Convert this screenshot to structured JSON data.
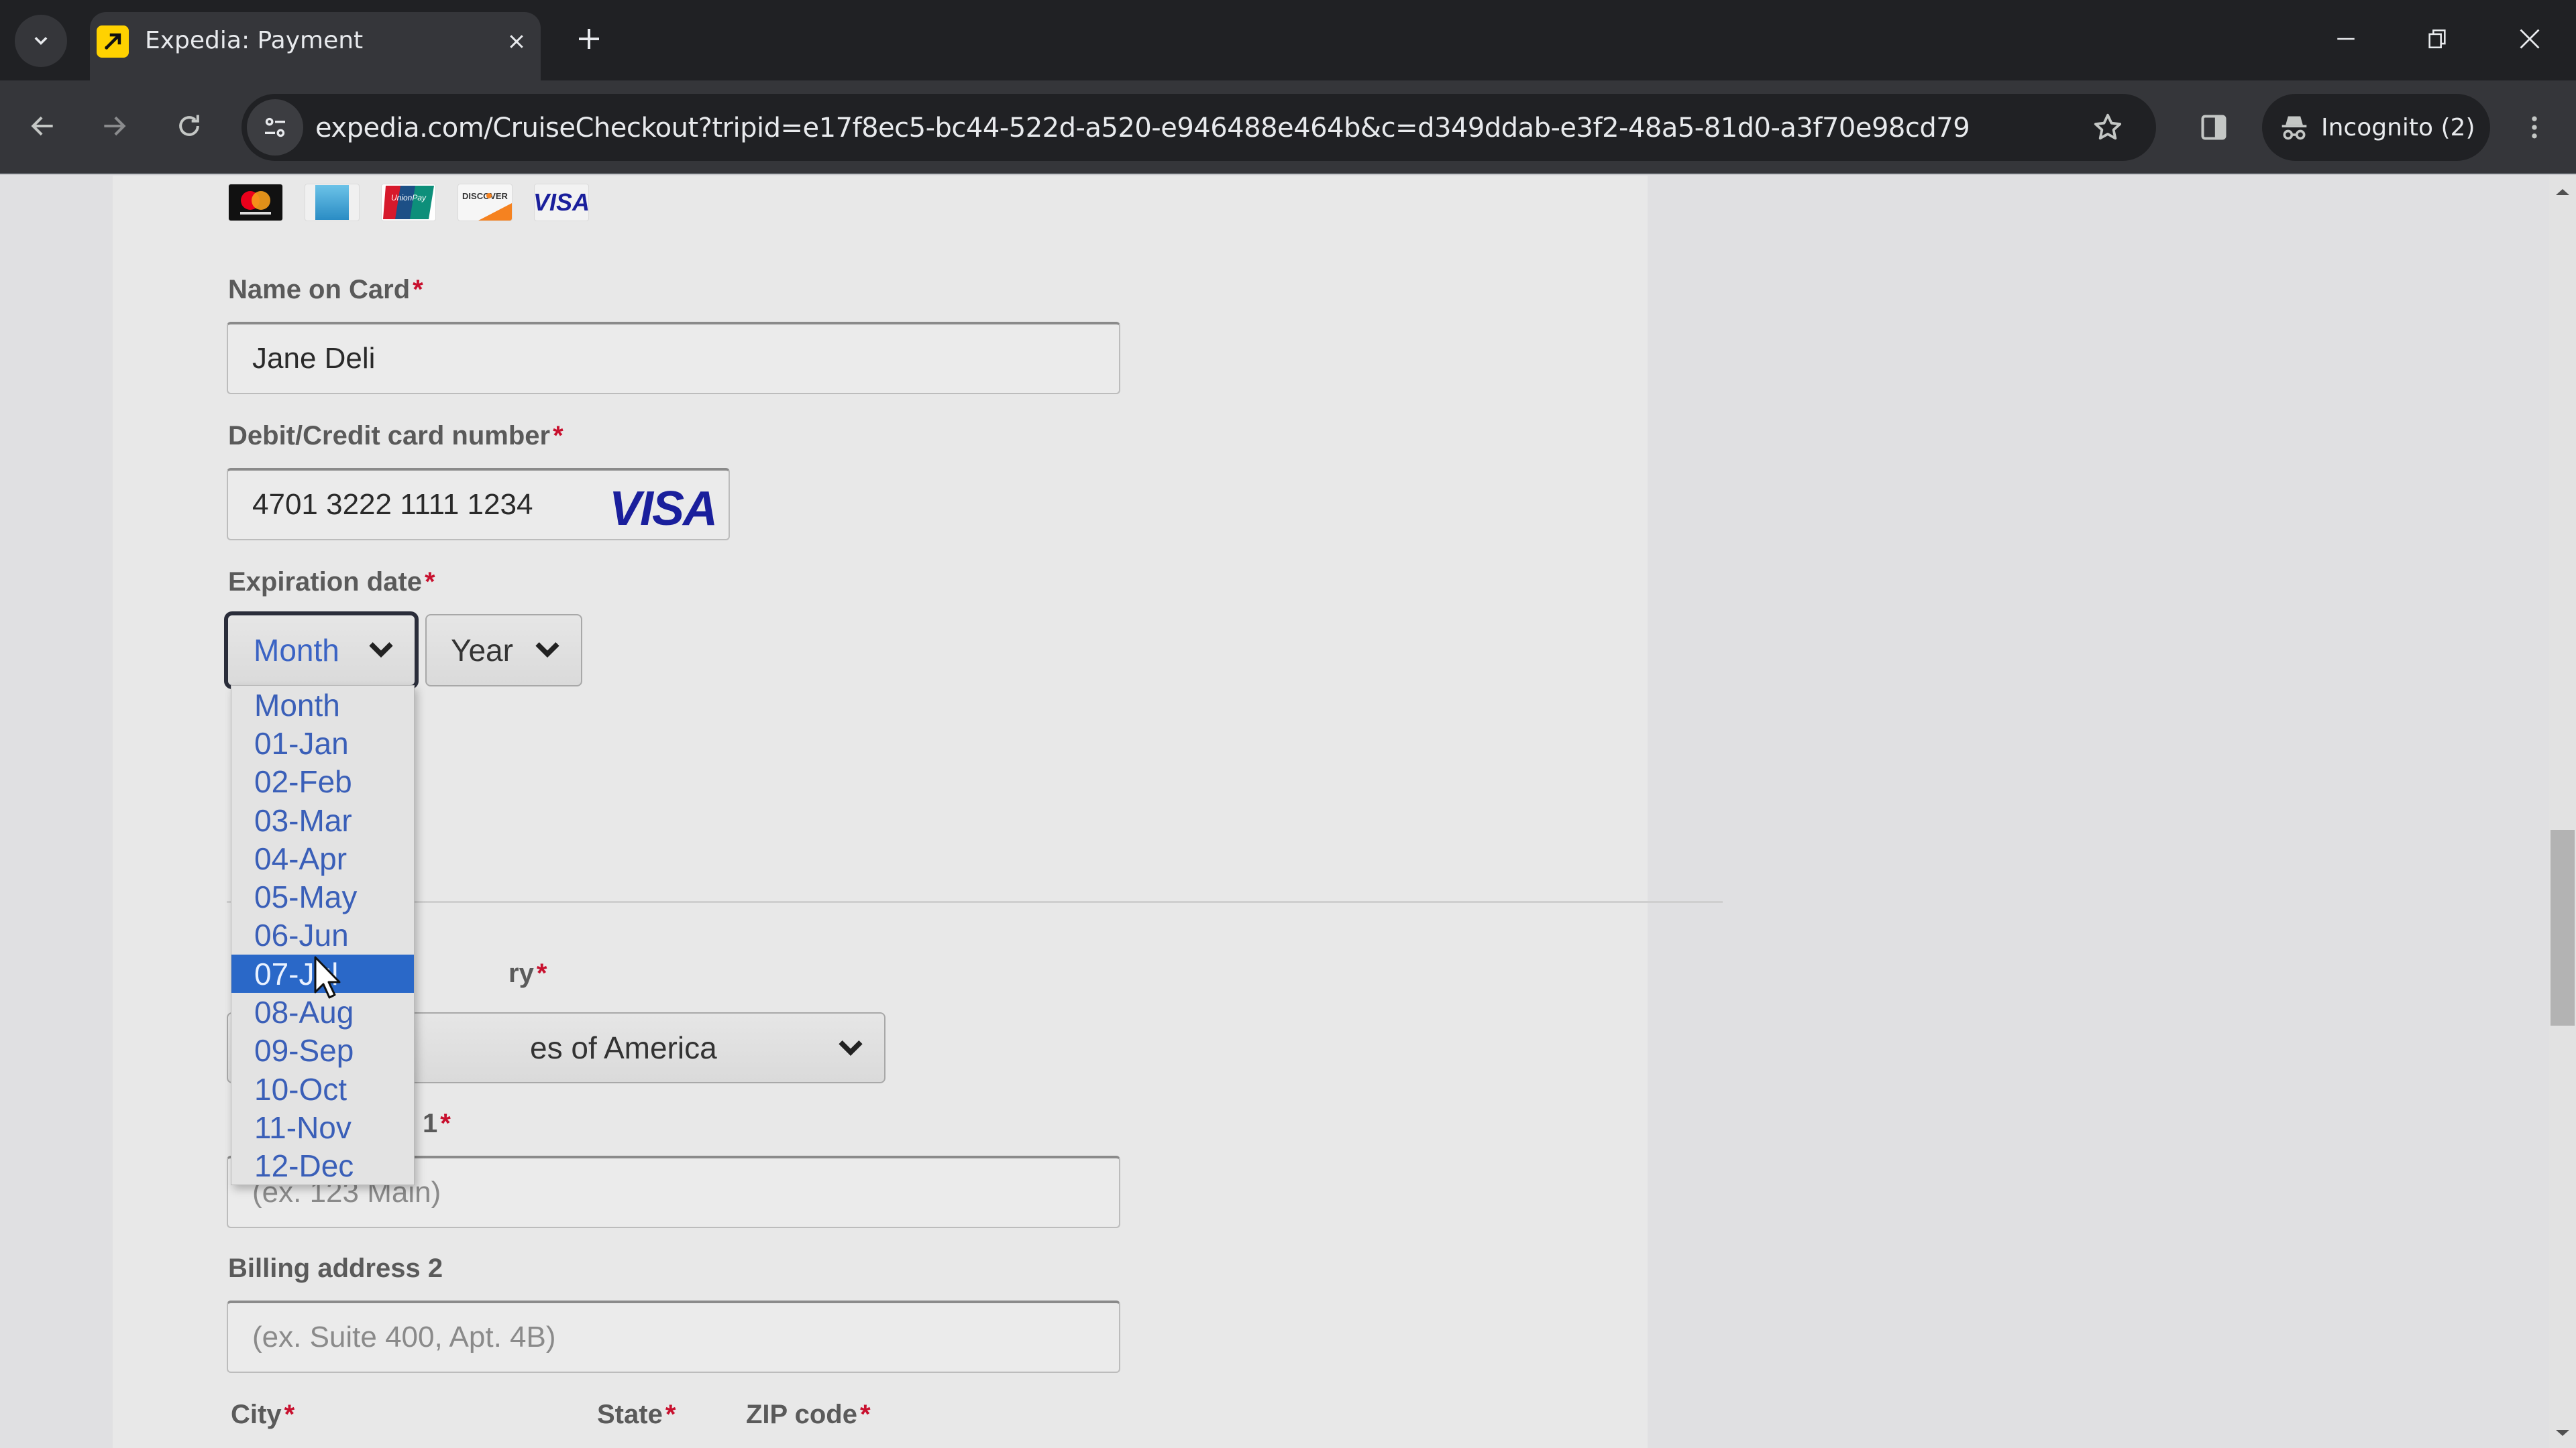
{
  "browser": {
    "tab_title": "Expedia: Payment",
    "url": "expedia.com/CruiseCheckout?tripid=e17f8ec5-bc44-522d-a520-e946488e464b&c=d349ddab-e3f2-48a5-81d0-a3f70e98cd79",
    "incognito_label": "Incognito (2)",
    "icons": {
      "tab_list": "chevron-down-icon",
      "favicon": "expedia-logo-icon",
      "tab_close": "close-icon",
      "new_tab": "plus-icon",
      "minimize": "minimize-icon",
      "restore": "restore-icon",
      "close_window": "close-icon",
      "back": "arrow-left-icon",
      "forward": "arrow-right-icon",
      "reload": "reload-icon",
      "site_info": "tune-icon",
      "bookmark": "star-icon",
      "side_panel": "side-panel-icon",
      "incognito": "incognito-icon",
      "menu": "more-vertical-icon"
    },
    "colors": {
      "favicon_bg": "#ffd200",
      "tabstrip": "#202124",
      "toolbar": "#35363a"
    }
  },
  "payment_form": {
    "accepted_cards": [
      "Mastercard",
      "American Express",
      "UnionPay",
      "Discover",
      "Visa"
    ],
    "name_on_card": {
      "label": "Name on Card",
      "required": "*",
      "value": "Jane Deli"
    },
    "card_number": {
      "label": "Debit/Credit card number",
      "required": "*",
      "value": "4701 3222 1111 1234",
      "detected_brand": "VISA"
    },
    "expiration": {
      "label": "Expiration date",
      "required": "*",
      "month": {
        "selected": "Month",
        "highlighted": "07-Jul",
        "options": [
          "Month",
          "01-Jan",
          "02-Feb",
          "03-Mar",
          "04-Apr",
          "05-May",
          "06-Jun",
          "07-Jul",
          "08-Aug",
          "09-Sep",
          "10-Oct",
          "11-Nov",
          "12-Dec"
        ]
      },
      "year": {
        "selected": "Year"
      }
    },
    "country": {
      "label_partial": "ry",
      "required": "*",
      "value_partial": "es of America"
    },
    "billing_address_1": {
      "label_partial": "1",
      "required": "*",
      "placeholder": "(ex. 123 Main)"
    },
    "billing_address_2": {
      "label": "Billing address 2",
      "placeholder": "(ex. Suite 400, Apt. 4B)"
    },
    "city": {
      "label": "City",
      "required": "*"
    },
    "state": {
      "label": "State",
      "required": "*"
    },
    "zip": {
      "label": "ZIP code",
      "required": "*"
    },
    "colors": {
      "required": "#c8102e",
      "option_text": "#3a5fb8",
      "option_highlight": "#2a68c8",
      "visa_blue": "#1a1f9c"
    }
  },
  "scrollbar": {
    "position_fraction": 0.47
  }
}
